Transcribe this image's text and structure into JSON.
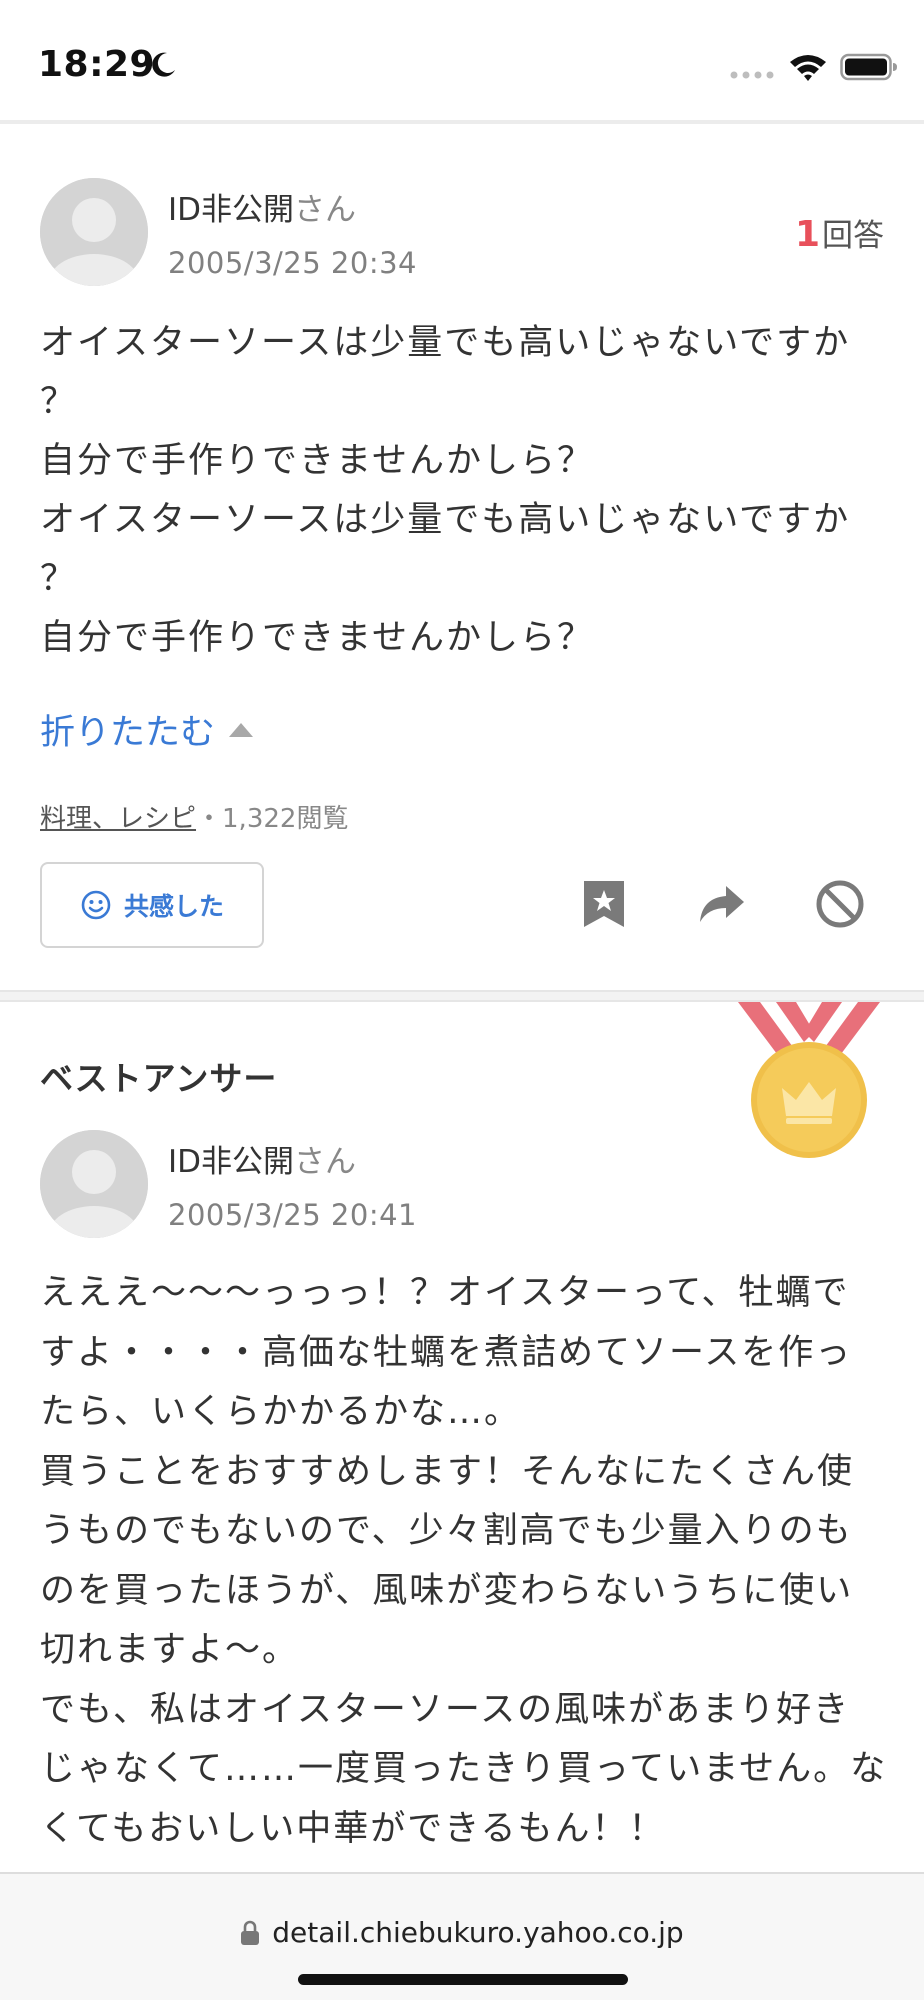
{
  "status_bar": {
    "time": "18:29",
    "icons": [
      "moon-icon",
      "signal-icon",
      "wifi-icon",
      "battery-icon"
    ]
  },
  "question": {
    "user_name": "ID非公開",
    "user_suffix": "さん",
    "date": "2005/3/25 20:34",
    "answer_count": "1",
    "answer_count_label": "回答",
    "body": "オイスターソースは少量でも高いじゃないですか\n？\n自分で手作りできませんかしら？\nオイスターソースは少量でも高いじゃないですか\n？\n自分で手作りできませんかしら？",
    "fold_label": "折りたたむ",
    "category": "料理、レシピ",
    "views": "・1,322閲覧",
    "empathy_label": "共感した",
    "actions": [
      "bookmark-icon",
      "share-icon",
      "block-icon"
    ]
  },
  "best_answer": {
    "title": "ベストアンサー",
    "user_name": "ID非公開",
    "user_suffix": "さん",
    "date": "2005/3/25 20:41",
    "body": "えええ〜〜〜っっっ！？オイスターって、牡蠣で\nすよ・・・・高価な牡蠣を煮詰めてソースを作っ\nたら、いくらかかるかな…。\n買うことをおすすめします！そんなにたくさん使\nうものでもないので、少々割高でも少量入りのも\nのを買ったほうが、風味が変わらないうちに使い\n切れますよ〜。\nでも、私はオイスターソースの風味があまり好き\nじゃなくて……一度買ったきり買っていません。な\nくてもおいしい中華ができるもん！！"
  },
  "browser": {
    "url": "detail.chiebukuro.yahoo.co.jp"
  },
  "colors": {
    "accent_blue": "#3a7ad5",
    "answer_count_red": "#e8505b",
    "medal_gold": "#f3c64f",
    "ribbon_red": "#e8707a"
  }
}
